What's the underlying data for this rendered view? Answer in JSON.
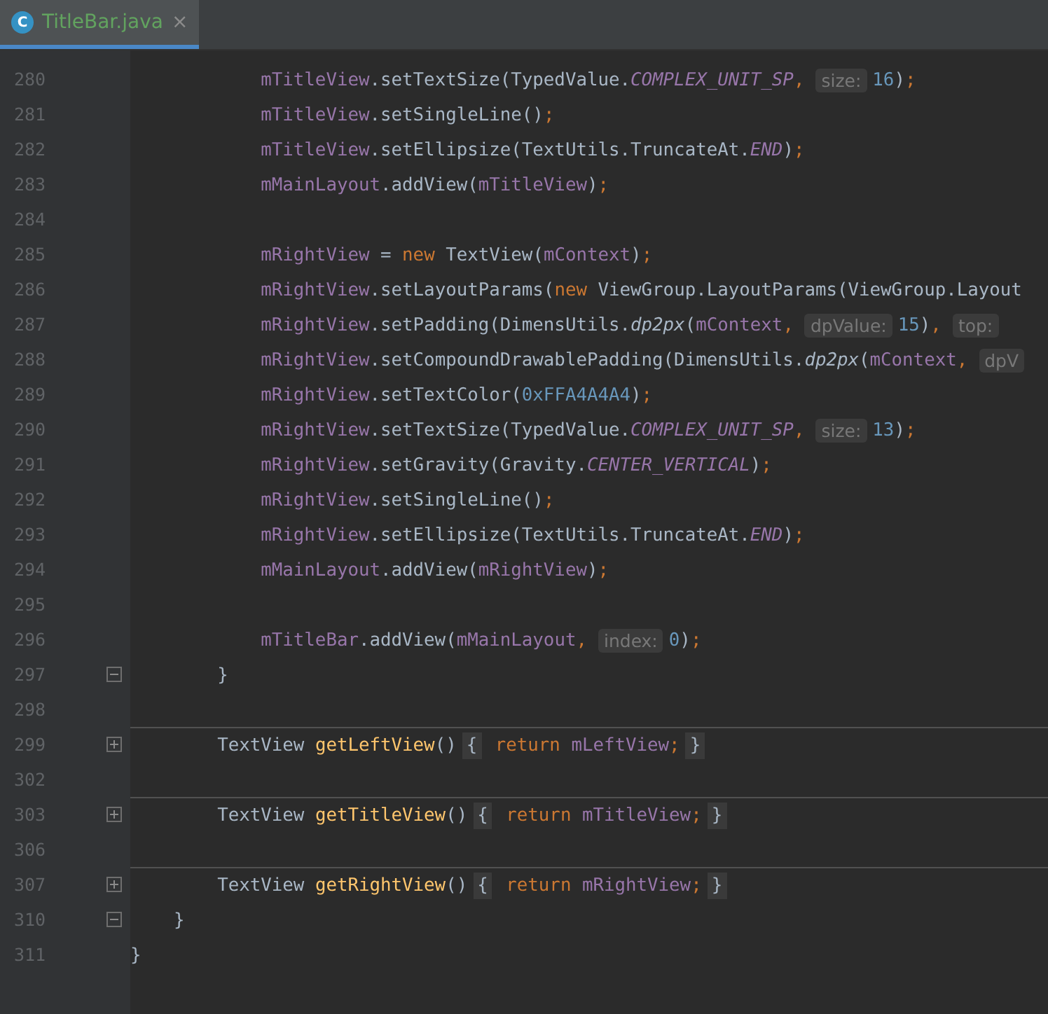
{
  "tabs": [
    {
      "icon_letter": "C",
      "title": "TitleBar.java",
      "close": "×",
      "selected": true
    }
  ],
  "lines": [
    {
      "number": "280",
      "separator": false,
      "tokens": [
        {
          "kind": "field",
          "text": "            mTitleView"
        },
        {
          "kind": "plain",
          "text": ".setTextSize(TypedValue."
        },
        {
          "kind": "constant",
          "text": "COMPLEX_UNIT_SP"
        },
        {
          "kind": "punct",
          "text": ","
        },
        {
          "kind": "hint",
          "text": "size:"
        },
        {
          "kind": "number",
          "text": "16"
        },
        {
          "kind": "plain",
          "text": ")"
        },
        {
          "kind": "punct",
          "text": ";"
        }
      ]
    },
    {
      "number": "281",
      "separator": false,
      "tokens": [
        {
          "kind": "field",
          "text": "            mTitleView"
        },
        {
          "kind": "plain",
          "text": ".setSingleLine()"
        },
        {
          "kind": "punct",
          "text": ";"
        }
      ]
    },
    {
      "number": "282",
      "separator": false,
      "tokens": [
        {
          "kind": "field",
          "text": "            mTitleView"
        },
        {
          "kind": "plain",
          "text": ".setEllipsize(TextUtils.TruncateAt."
        },
        {
          "kind": "constant",
          "text": "END"
        },
        {
          "kind": "plain",
          "text": ")"
        },
        {
          "kind": "punct",
          "text": ";"
        }
      ]
    },
    {
      "number": "283",
      "separator": false,
      "tokens": [
        {
          "kind": "field",
          "text": "            mMainLayout"
        },
        {
          "kind": "plain",
          "text": ".addView("
        },
        {
          "kind": "field",
          "text": "mTitleView"
        },
        {
          "kind": "plain",
          "text": ")"
        },
        {
          "kind": "punct",
          "text": ";"
        }
      ]
    },
    {
      "number": "284",
      "separator": false
    },
    {
      "number": "285",
      "separator": false,
      "tokens": [
        {
          "kind": "field",
          "text": "            mRightView"
        },
        {
          "kind": "plain",
          "text": " = "
        },
        {
          "kind": "keyword",
          "text": "new"
        },
        {
          "kind": "plain",
          "text": " TextView("
        },
        {
          "kind": "field",
          "text": "mContext"
        },
        {
          "kind": "plain",
          "text": ")"
        },
        {
          "kind": "punct",
          "text": ";"
        }
      ]
    },
    {
      "number": "286",
      "separator": false,
      "tokens": [
        {
          "kind": "field",
          "text": "            mRightView"
        },
        {
          "kind": "plain",
          "text": ".setLayoutParams("
        },
        {
          "kind": "keyword",
          "text": "new"
        },
        {
          "kind": "plain",
          "text": " ViewGroup.LayoutParams(ViewGroup.Layout"
        }
      ]
    },
    {
      "number": "287",
      "separator": false,
      "tokens": [
        {
          "kind": "field",
          "text": "            mRightView"
        },
        {
          "kind": "plain",
          "text": ".setPadding(DimensUtils."
        },
        {
          "kind": "static",
          "text": "dp2px"
        },
        {
          "kind": "plain",
          "text": "("
        },
        {
          "kind": "field",
          "text": "mContext"
        },
        {
          "kind": "punct",
          "text": ","
        },
        {
          "kind": "hint",
          "text": "dpValue:"
        },
        {
          "kind": "number",
          "text": "15"
        },
        {
          "kind": "plain",
          "text": ")"
        },
        {
          "kind": "punct",
          "text": ","
        },
        {
          "kind": "hint",
          "text": "top:"
        }
      ]
    },
    {
      "number": "288",
      "separator": false,
      "tokens": [
        {
          "kind": "field",
          "text": "            mRightView"
        },
        {
          "kind": "plain",
          "text": ".setCompoundDrawablePadding(DimensUtils."
        },
        {
          "kind": "static",
          "text": "dp2px"
        },
        {
          "kind": "plain",
          "text": "("
        },
        {
          "kind": "field",
          "text": "mContext"
        },
        {
          "kind": "punct",
          "text": ","
        },
        {
          "kind": "hint",
          "text": "dpV"
        }
      ]
    },
    {
      "number": "289",
      "separator": false,
      "tokens": [
        {
          "kind": "field",
          "text": "            mRightView"
        },
        {
          "kind": "plain",
          "text": ".setTextColor("
        },
        {
          "kind": "number",
          "text": "0xFFA4A4A4"
        },
        {
          "kind": "plain",
          "text": ")"
        },
        {
          "kind": "punct",
          "text": ";"
        }
      ]
    },
    {
      "number": "290",
      "separator": false,
      "tokens": [
        {
          "kind": "field",
          "text": "            mRightView"
        },
        {
          "kind": "plain",
          "text": ".setTextSize(TypedValue."
        },
        {
          "kind": "constant",
          "text": "COMPLEX_UNIT_SP"
        },
        {
          "kind": "punct",
          "text": ","
        },
        {
          "kind": "hint",
          "text": "size:"
        },
        {
          "kind": "number",
          "text": "13"
        },
        {
          "kind": "plain",
          "text": ")"
        },
        {
          "kind": "punct",
          "text": ";"
        }
      ]
    },
    {
      "number": "291",
      "separator": false,
      "tokens": [
        {
          "kind": "field",
          "text": "            mRightView"
        },
        {
          "kind": "plain",
          "text": ".setGravity(Gravity."
        },
        {
          "kind": "constant",
          "text": "CENTER_VERTICAL"
        },
        {
          "kind": "plain",
          "text": ")"
        },
        {
          "kind": "punct",
          "text": ";"
        }
      ]
    },
    {
      "number": "292",
      "separator": false,
      "tokens": [
        {
          "kind": "field",
          "text": "            mRightView"
        },
        {
          "kind": "plain",
          "text": ".setSingleLine()"
        },
        {
          "kind": "punct",
          "text": ";"
        }
      ]
    },
    {
      "number": "293",
      "separator": false,
      "tokens": [
        {
          "kind": "field",
          "text": "            mRightView"
        },
        {
          "kind": "plain",
          "text": ".setEllipsize(TextUtils.TruncateAt."
        },
        {
          "kind": "constant",
          "text": "END"
        },
        {
          "kind": "plain",
          "text": ")"
        },
        {
          "kind": "punct",
          "text": ";"
        }
      ]
    },
    {
      "number": "294",
      "separator": false,
      "tokens": [
        {
          "kind": "field",
          "text": "            mMainLayout"
        },
        {
          "kind": "plain",
          "text": ".addView("
        },
        {
          "kind": "field",
          "text": "mRightView"
        },
        {
          "kind": "plain",
          "text": ")"
        },
        {
          "kind": "punct",
          "text": ";"
        }
      ]
    },
    {
      "number": "295",
      "separator": false
    },
    {
      "number": "296",
      "separator": false,
      "tokens": [
        {
          "kind": "field",
          "text": "            mTitleBar"
        },
        {
          "kind": "plain",
          "text": ".addView("
        },
        {
          "kind": "field",
          "text": "mMainLayout"
        },
        {
          "kind": "punct",
          "text": ","
        },
        {
          "kind": "hint",
          "text": "index:"
        },
        {
          "kind": "number",
          "text": "0"
        },
        {
          "kind": "plain",
          "text": ")"
        },
        {
          "kind": "punct",
          "text": ";"
        }
      ]
    },
    {
      "number": "297",
      "folded": false,
      "separator": false,
      "tokens": [
        {
          "kind": "plain",
          "text": "        }"
        }
      ]
    },
    {
      "number": "298",
      "separator": false
    },
    {
      "number": "299",
      "folded": true,
      "separator": true,
      "tokens": [
        {
          "kind": "plain",
          "text": "        TextView "
        },
        {
          "kind": "declaration",
          "text": "getLeftView"
        },
        {
          "kind": "plain",
          "text": "()"
        },
        {
          "kind": "brace",
          "text": "{"
        },
        {
          "kind": "keyword",
          "text": " return"
        },
        {
          "kind": "field",
          "text": " mLeftView"
        },
        {
          "kind": "punct",
          "text": ";"
        },
        {
          "kind": "brace",
          "text": "}"
        }
      ]
    },
    {
      "number": "302",
      "separator": false
    },
    {
      "number": "303",
      "folded": true,
      "separator": true,
      "tokens": [
        {
          "kind": "plain",
          "text": "        TextView "
        },
        {
          "kind": "declaration",
          "text": "getTitleView"
        },
        {
          "kind": "plain",
          "text": "()"
        },
        {
          "kind": "brace",
          "text": "{"
        },
        {
          "kind": "keyword",
          "text": " return"
        },
        {
          "kind": "field",
          "text": " mTitleView"
        },
        {
          "kind": "punct",
          "text": ";"
        },
        {
          "kind": "brace",
          "text": "}"
        }
      ]
    },
    {
      "number": "306",
      "separator": false
    },
    {
      "number": "307",
      "folded": true,
      "separator": true,
      "tokens": [
        {
          "kind": "plain",
          "text": "        TextView "
        },
        {
          "kind": "declaration",
          "text": "getRightView"
        },
        {
          "kind": "plain",
          "text": "()"
        },
        {
          "kind": "brace",
          "text": "{"
        },
        {
          "kind": "keyword",
          "text": " return"
        },
        {
          "kind": "field",
          "text": " mRightView"
        },
        {
          "kind": "punct",
          "text": ";"
        },
        {
          "kind": "brace",
          "text": "}"
        }
      ]
    },
    {
      "number": "310",
      "folded": false,
      "separator": false,
      "tokens": [
        {
          "kind": "plain",
          "text": "    }"
        }
      ]
    },
    {
      "number": "311",
      "separator": false,
      "tokens": [
        {
          "kind": "plain",
          "text": "}"
        }
      ]
    }
  ]
}
